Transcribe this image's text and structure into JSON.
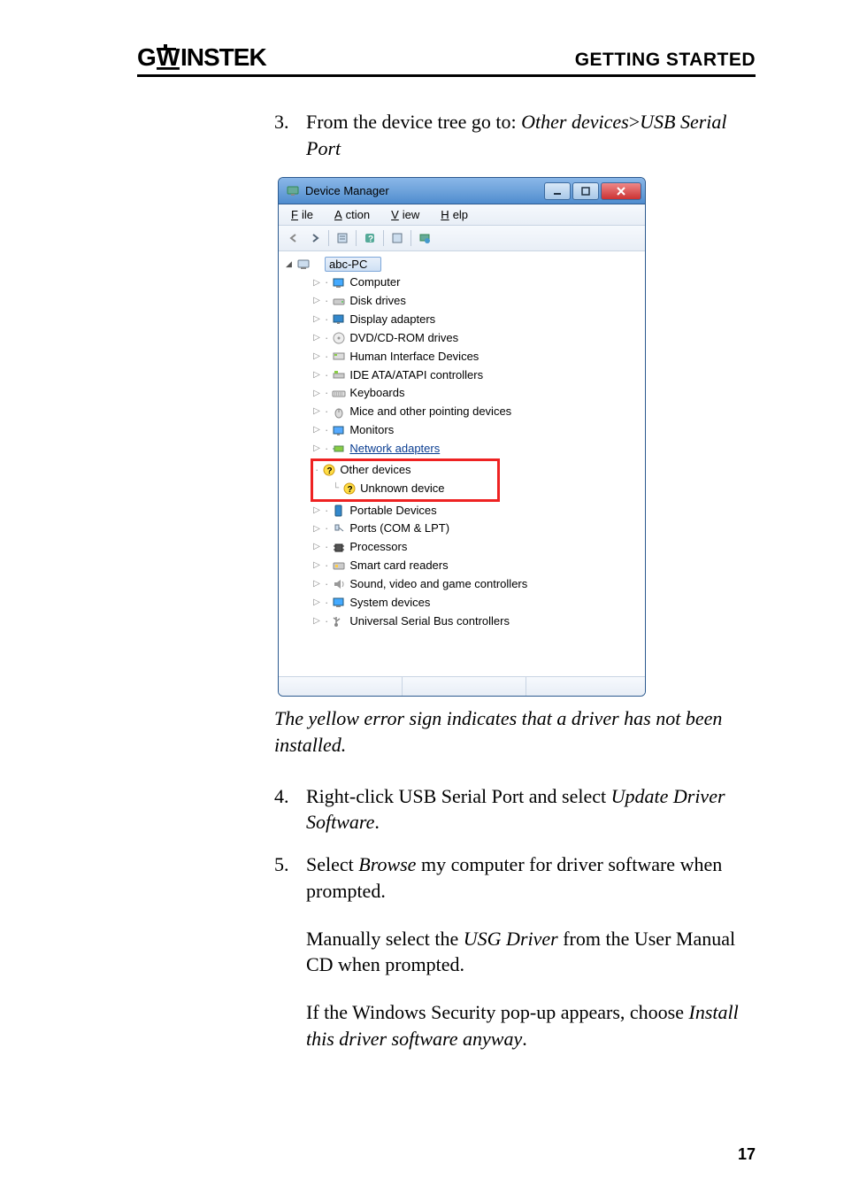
{
  "header": {
    "logo_text": "GWINSTEK",
    "title": "GETTING STARTED"
  },
  "steps": {
    "s3": {
      "num": "3.",
      "prefix": "From the device tree go to: ",
      "path1": "Other devices",
      "sep": ">",
      "path2": "USB Serial Port"
    },
    "s4": {
      "num": "4.",
      "prefix": "Right-click USB Serial Port and select ",
      "action": "Update Driver Software",
      "suffix": "."
    },
    "s5": {
      "num": "5.",
      "prefix": "Select ",
      "action": "Browse",
      "suffix": " my computer for driver software when prompted."
    }
  },
  "caption": "The yellow error sign indicates that a driver has not been installed.",
  "paras": {
    "p1a": "Manually select the ",
    "p1b": "USG Driver",
    "p1c": " from the User Manual CD when prompted.",
    "p2a": "If the Windows Security pop-up appears, choose ",
    "p2b": "Install this driver software anyway",
    "p2c": "."
  },
  "devmgr": {
    "title": "Device Manager",
    "menus": {
      "file": "File",
      "action": "Action",
      "view": "View",
      "help": "Help"
    },
    "root": "abc-PC",
    "nodes": {
      "computer": "Computer",
      "disk": "Disk drives",
      "display": "Display adapters",
      "dvd": "DVD/CD-ROM drives",
      "hid": "Human Interface Devices",
      "ide": "IDE ATA/ATAPI controllers",
      "keyboards": "Keyboards",
      "mice": "Mice and other pointing devices",
      "monitors": "Monitors",
      "network": "Network adapters",
      "other": "Other devices",
      "unknown": "Unknown device",
      "portable": "Portable Devices",
      "ports": "Ports (COM & LPT)",
      "processors": "Processors",
      "smartcard": "Smart card readers",
      "sound": "Sound, video and game controllers",
      "system": "System devices",
      "usb": "Universal Serial Bus controllers"
    }
  },
  "page_number": "17"
}
